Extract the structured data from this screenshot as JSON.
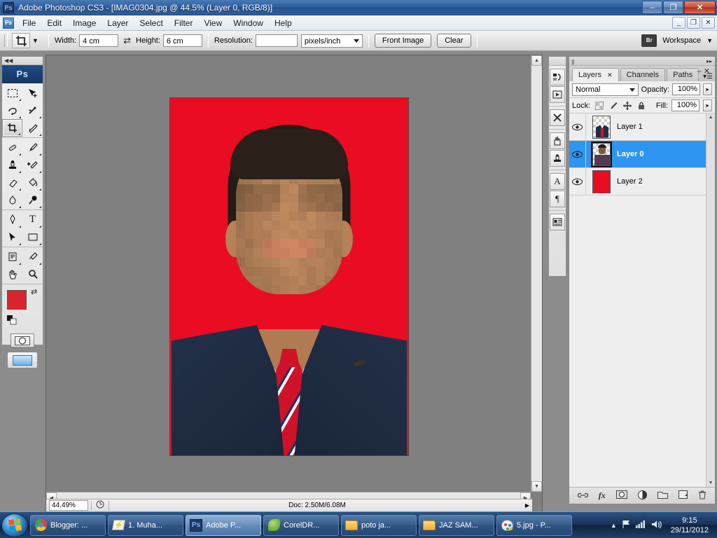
{
  "window": {
    "app_icon": "photoshop-logo-icon",
    "title": "Adobe Photoshop CS3 - [IMAG0304.jpg @ 44.5% (Layer 0, RGB/8)]",
    "minimize": "–",
    "restore": "❐",
    "close": "✕"
  },
  "menubar": {
    "items": [
      "File",
      "Edit",
      "Image",
      "Layer",
      "Select",
      "Filter",
      "View",
      "Window",
      "Help"
    ],
    "doc_minimize": "_",
    "doc_restore": "❐",
    "doc_close": "✕"
  },
  "options_bar": {
    "tool_icon": "crop-tool-icon",
    "width_label": "Width:",
    "width_value": "4 cm",
    "swap_icon": "⇄",
    "height_label": "Height:",
    "height_value": "6 cm",
    "resolution_label": "Resolution:",
    "resolution_value": "",
    "resolution_units": "pixels/inch",
    "front_image_label": "Front Image",
    "clear_label": "Clear",
    "bridge_icon": "Br",
    "workspace_label": "Workspace",
    "workspace_arrow": "▼"
  },
  "toolbox": {
    "logo": "Ps",
    "collapse_icon": "◀◀",
    "tools": [
      [
        {
          "icon": "marquee-tool-icon",
          "glyph": "▭",
          "selected": false
        },
        {
          "icon": "move-tool-icon",
          "glyph": "➤",
          "selected": false
        }
      ],
      [
        {
          "icon": "lasso-tool-icon",
          "glyph": "♆",
          "selected": false
        },
        {
          "icon": "magic-wand-tool-icon",
          "glyph": "✳",
          "selected": false
        }
      ],
      [
        {
          "icon": "crop-tool-icon",
          "glyph": "⛶",
          "selected": true
        },
        {
          "icon": "slice-tool-icon",
          "glyph": "🔪",
          "selected": false
        }
      ],
      [
        {
          "icon": "healing-brush-tool-icon",
          "glyph": "✏",
          "selected": false
        },
        {
          "icon": "brush-tool-icon",
          "glyph": "🖌",
          "selected": false
        }
      ],
      [
        {
          "icon": "clone-stamp-tool-icon",
          "glyph": "⚱",
          "selected": false
        },
        {
          "icon": "history-brush-tool-icon",
          "glyph": "✎",
          "selected": false
        }
      ],
      [
        {
          "icon": "eraser-tool-icon",
          "glyph": "▱",
          "selected": false
        },
        {
          "icon": "paint-bucket-tool-icon",
          "glyph": "⬟",
          "selected": false
        }
      ],
      [
        {
          "icon": "blur-tool-icon",
          "glyph": "💧",
          "selected": false
        },
        {
          "icon": "dodge-tool-icon",
          "glyph": "🍭",
          "selected": false
        }
      ],
      [
        {
          "icon": "pen-tool-icon",
          "glyph": "✒",
          "selected": false
        },
        {
          "icon": "type-tool-icon",
          "glyph": "T",
          "selected": false
        }
      ],
      [
        {
          "icon": "path-selection-tool-icon",
          "glyph": "➤",
          "selected": false
        },
        {
          "icon": "shape-tool-icon",
          "glyph": "▬",
          "selected": false
        }
      ],
      [
        {
          "icon": "notes-tool-icon",
          "glyph": "🗒",
          "selected": false
        },
        {
          "icon": "eyedropper-tool-icon",
          "glyph": "💉",
          "selected": false
        }
      ],
      [
        {
          "icon": "hand-tool-icon",
          "glyph": "✋",
          "selected": false
        },
        {
          "icon": "zoom-tool-icon",
          "glyph": "🔍",
          "selected": false
        }
      ]
    ],
    "foreground_color": "#d9232e",
    "background_color": "#ffffff",
    "swap_colors_icon": "⇄",
    "default_colors_icon": "default-colors-icon",
    "quick_mask_icon": "quick-mask-icon",
    "screen_mode_icon": "screen-mode-icon"
  },
  "icon_dock": {
    "collapse_icon": "◀◀",
    "buttons": [
      {
        "name": "history-panel-icon",
        "glyph": "↺"
      },
      {
        "name": "actions-panel-icon",
        "glyph": "▶"
      },
      {
        "name": "tool-presets-panel-icon",
        "glyph": "⚒"
      },
      {
        "name": "brushes-panel-icon",
        "glyph": "🖌"
      },
      {
        "name": "clone-source-panel-icon",
        "glyph": "⚱"
      },
      {
        "name": "character-panel-icon",
        "glyph": "A"
      },
      {
        "name": "paragraph-panel-icon",
        "glyph": "¶"
      },
      {
        "name": "layer-comps-panel-icon",
        "glyph": "▤"
      }
    ]
  },
  "layers_panel": {
    "grip_icon": "|||",
    "expand_icon": "▸▸",
    "minimize_icon": "–",
    "close_icon": "✕",
    "menu_icon": "▾☰",
    "tabs": [
      {
        "label": "Layers",
        "active": true,
        "close": "✕"
      },
      {
        "label": "Channels",
        "active": false,
        "close": ""
      },
      {
        "label": "Paths",
        "active": false,
        "close": ""
      }
    ],
    "blend_mode": "Normal",
    "opacity_label": "Opacity:",
    "opacity_value": "100%",
    "lock_label": "Lock:",
    "lock_icons": [
      {
        "name": "lock-transparency-icon",
        "glyph": "▨"
      },
      {
        "name": "lock-image-pixels-icon",
        "glyph": "🖌"
      },
      {
        "name": "lock-position-icon",
        "glyph": "✥"
      },
      {
        "name": "lock-all-icon",
        "glyph": "🔒"
      }
    ],
    "fill_label": "Fill:",
    "fill_value": "100%",
    "layers": [
      {
        "name": "Layer 1",
        "visible": true,
        "selected": false,
        "thumb": "suit-thumbnail",
        "thumb_color": "#1e2c44"
      },
      {
        "name": "Layer 0",
        "visible": true,
        "selected": true,
        "thumb": "portrait-thumbnail",
        "thumb_color": "#7d5a3f"
      },
      {
        "name": "Layer 2",
        "visible": true,
        "selected": false,
        "thumb": "red-fill-thumbnail",
        "thumb_color": "#ea0c22"
      }
    ],
    "eye_icon": "👁",
    "footer_icons": [
      {
        "name": "link-layers-icon",
        "glyph": "🔗"
      },
      {
        "name": "layer-style-fx-icon",
        "glyph": "fx"
      },
      {
        "name": "add-layer-mask-icon",
        "glyph": "◻"
      },
      {
        "name": "new-adjustment-layer-icon",
        "glyph": "◐"
      },
      {
        "name": "new-group-icon",
        "glyph": "🗀"
      },
      {
        "name": "new-layer-icon",
        "glyph": "❐"
      },
      {
        "name": "delete-layer-icon",
        "glyph": "🗑"
      }
    ]
  },
  "document": {
    "zoom_level": "44.49%",
    "status_icon": "document-status-icon",
    "doc_size": "Doc: 2.50M/6.08M",
    "status_arrow": "▶",
    "scroll_up": "▲",
    "scroll_down": "▼",
    "scroll_left": "◀",
    "scroll_right": "▶",
    "image": {
      "background_color": "#ea0c22",
      "suit_color": "#1e2c44",
      "shirt_color": "#f4f4f2",
      "tie_color": "#cf1228",
      "skin_color": "#c08f63",
      "hair_color": "#241c17"
    }
  },
  "taskbar": {
    "start_label": "windows-start-orb",
    "buttons": [
      {
        "label": "Blogger: ...",
        "icon": "chrome-icon",
        "active": false
      },
      {
        "label": "1. Muha...",
        "icon": "winamp-icon",
        "active": false
      },
      {
        "label": "Adobe P...",
        "icon": "photoshop-icon",
        "active": true
      },
      {
        "label": "CorelDR...",
        "icon": "coreldraw-icon",
        "active": false
      },
      {
        "label": "poto ja...",
        "icon": "folder-icon",
        "active": false
      },
      {
        "label": "JAZ SAM...",
        "icon": "folder-icon",
        "active": false
      },
      {
        "label": "5.jpg - P...",
        "icon": "paint-icon",
        "active": false
      }
    ],
    "tray": {
      "show_hidden_icon": "▲",
      "action_center_icon": "⚐",
      "network_icon": "▂▄▆",
      "volume_icon": "🔊",
      "time": "9:15",
      "date": "29/11/2012"
    }
  }
}
